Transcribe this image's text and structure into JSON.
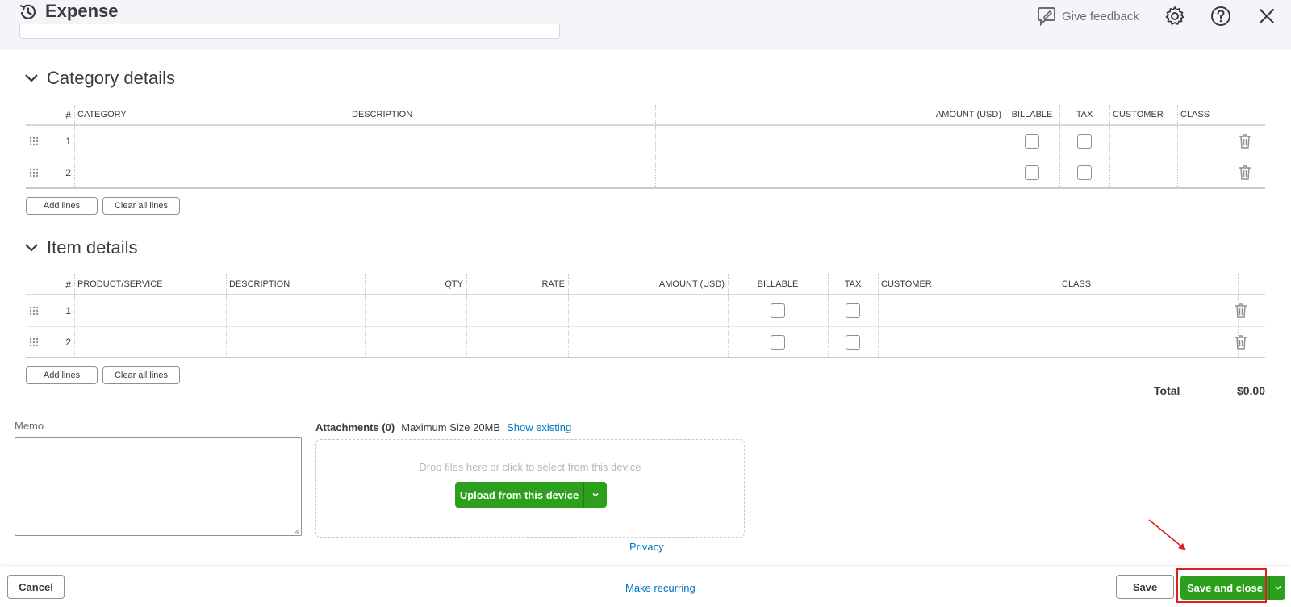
{
  "header": {
    "title": "Expense",
    "feedback_label": "Give feedback",
    "icons": [
      "history-icon",
      "feedback-icon",
      "gear-icon",
      "help-icon",
      "close-icon"
    ]
  },
  "category_section": {
    "title": "Category details",
    "columns": [
      "#",
      "CATEGORY",
      "DESCRIPTION",
      "AMOUNT (USD)",
      "BILLABLE",
      "TAX",
      "CUSTOMER",
      "CLASS"
    ],
    "rows": [
      {
        "num": "1"
      },
      {
        "num": "2"
      }
    ],
    "add_lines_label": "Add lines",
    "clear_lines_label": "Clear all lines"
  },
  "item_section": {
    "title": "Item details",
    "columns": [
      "#",
      "PRODUCT/SERVICE",
      "DESCRIPTION",
      "QTY",
      "RATE",
      "AMOUNT (USD)",
      "BILLABLE",
      "TAX",
      "CUSTOMER",
      "CLASS"
    ],
    "rows": [
      {
        "num": "1"
      },
      {
        "num": "2"
      }
    ],
    "add_lines_label": "Add lines",
    "clear_lines_label": "Clear all lines"
  },
  "total": {
    "label": "Total",
    "value": "$0.00"
  },
  "memo": {
    "label": "Memo",
    "value": ""
  },
  "attachments": {
    "title": "Attachments (0)",
    "max_size": "Maximum Size 20MB",
    "show_existing": "Show existing",
    "drop_hint": "Drop files here or click to select from this device",
    "upload_label": "Upload from this device",
    "privacy": "Privacy"
  },
  "footer": {
    "cancel_label": "Cancel",
    "make_recurring_label": "Make recurring",
    "save_label": "Save",
    "save_close_label": "Save and close"
  },
  "colors": {
    "primary_green": "#2ca01c",
    "link_blue": "#0077c5",
    "annotation_red": "#e02020",
    "header_bg": "#f4f5f8"
  }
}
